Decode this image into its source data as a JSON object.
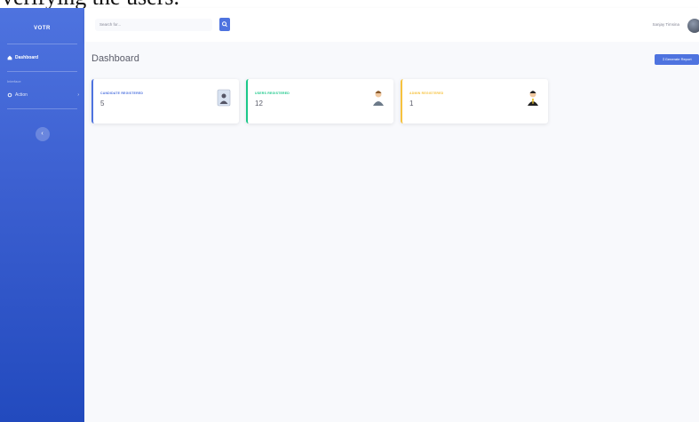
{
  "caption": "verifying the users.",
  "sidebar": {
    "brand": "VOTR",
    "dashboard_label": "Dashboard",
    "section_heading": "Interface",
    "action_label": "Action",
    "accent_color": "#4e73df"
  },
  "topbar": {
    "search_placeholder": "Search for...",
    "user_name": "Sanjay Timsina"
  },
  "page": {
    "title": "Dashboard",
    "report_button": "Generate Report"
  },
  "cards": [
    {
      "label": "CANDIDATE REGISTERED",
      "value": "5",
      "color": "#4e73df",
      "icon": "id-card-icon"
    },
    {
      "label": "USERS REGISTERED",
      "value": "12",
      "color": "#1cc88a",
      "icon": "user-icon"
    },
    {
      "label": "ADMIN REGISTERED",
      "value": "1",
      "color": "#f6c23e",
      "icon": "admin-icon"
    }
  ]
}
